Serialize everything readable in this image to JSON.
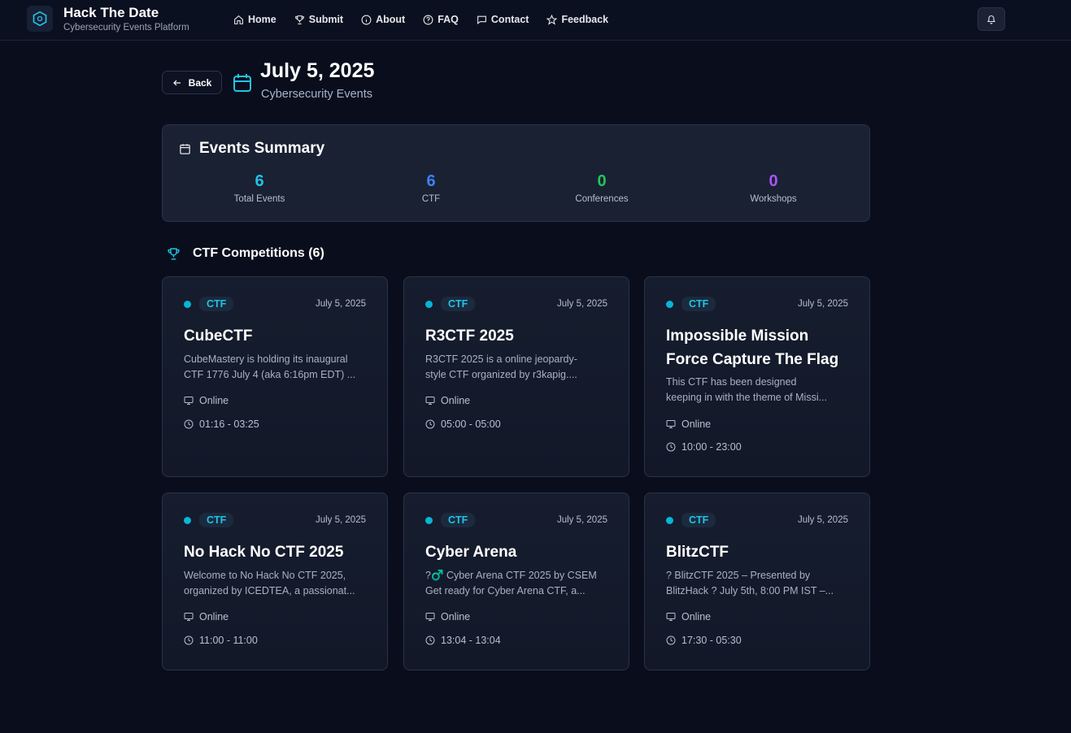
{
  "brand": {
    "title": "Hack The Date",
    "subtitle": "Cybersecurity Events Platform"
  },
  "nav": [
    {
      "label": "Home",
      "icon": "home-icon"
    },
    {
      "label": "Submit",
      "icon": "trophy-icon"
    },
    {
      "label": "About",
      "icon": "info-icon"
    },
    {
      "label": "FAQ",
      "icon": "help-circle-icon"
    },
    {
      "label": "Contact",
      "icon": "message-icon"
    },
    {
      "label": "Feedback",
      "icon": "star-icon"
    }
  ],
  "header": {
    "back_label": "Back",
    "title": "July 5, 2025",
    "subtitle": "Cybersecurity Events"
  },
  "summary": {
    "title": "Events Summary",
    "stats": [
      {
        "value": "6",
        "label": "Total Events",
        "color": "#22c3e6"
      },
      {
        "value": "6",
        "label": "CTF",
        "color": "#3b82f6"
      },
      {
        "value": "0",
        "label": "Conferences",
        "color": "#22c55e"
      },
      {
        "value": "0",
        "label": "Workshops",
        "color": "#a855f7"
      }
    ]
  },
  "section": {
    "title": "CTF Competitions (6)"
  },
  "events": [
    {
      "badge": "CTF",
      "date": "July 5, 2025",
      "title_lines": [
        "CubeCTF"
      ],
      "desc_lines": [
        "CubeMastery is holding its inaugural",
        "CTF 1776 July 4 (aka 6:16pm EDT) ..."
      ],
      "location": "Online",
      "time": "01:16 - 03:25"
    },
    {
      "badge": "CTF",
      "date": "July 5, 2025",
      "title_lines": [
        "R3CTF 2025"
      ],
      "desc_lines": [
        "R3CTF 2025 is a online jeopardy-",
        "style CTF organized by r3kapig...."
      ],
      "location": "Online",
      "time": "05:00 - 05:00"
    },
    {
      "badge": "CTF",
      "date": "July 5, 2025",
      "title_lines": [
        "Impossible Mission",
        "Force Capture The Flag"
      ],
      "desc_lines": [
        "This CTF has been designed",
        "keeping in with the theme of Missi..."
      ],
      "location": "Online",
      "time": "10:00 - 23:00"
    },
    {
      "badge": "CTF",
      "date": "July 5, 2025",
      "title_lines": [
        "No Hack No CTF 2025"
      ],
      "desc_lines": [
        "Welcome to No Hack No CTF 2025,",
        "organized by ICEDTEA, a passionat..."
      ],
      "location": "Online",
      "time": "11:00 - 11:00"
    },
    {
      "badge": "CTF",
      "date": "July 5, 2025",
      "title_lines": [
        "Cyber Arena"
      ],
      "desc_lines": [
        "?♂️ Cyber Arena CTF 2025 by CSEM",
        "Get ready for Cyber Arena CTF, a..."
      ],
      "location": "Online",
      "time": "13:04 - 13:04"
    },
    {
      "badge": "CTF",
      "date": "July 5, 2025",
      "title_lines": [
        "BlitzCTF"
      ],
      "desc_lines": [
        "? BlitzCTF 2025 – Presented by",
        "BlitzHack ? July 5th, 8:00 PM IST –..."
      ],
      "location": "Online",
      "time": "17:30 - 05:30"
    }
  ]
}
